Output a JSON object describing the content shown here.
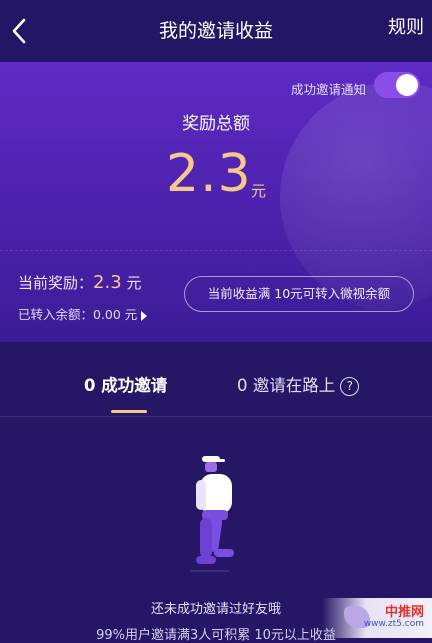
{
  "header": {
    "title": "我的邀请收益",
    "rules_label": "规则"
  },
  "summary": {
    "notify_label": "成功邀请通知",
    "notify_on": true,
    "total_label": "奖励总额",
    "total_amount": "2.3",
    "total_unit": "元",
    "current_label": "当前奖励：",
    "current_value": "2.3",
    "current_unit": "元",
    "transferred_text": "已转入余额：0.00 元",
    "convert_text": "当前收益满 10元可转入微视余额"
  },
  "tabs": [
    {
      "label": "0 成功邀请",
      "active": true
    },
    {
      "label": "0 邀请在路上",
      "active": false
    }
  ],
  "empty": {
    "line1": "还未成功邀请过好友哦",
    "line2": "99%用户邀请满3人可积累 10元以上收益"
  },
  "watermark": {
    "text": "中推网",
    "sub": "www.zt5.com"
  },
  "colors": {
    "background": "#251766",
    "card": "#5e2bc4",
    "accent_gold": "#f4c98b",
    "toggle": "#8b4dea"
  }
}
